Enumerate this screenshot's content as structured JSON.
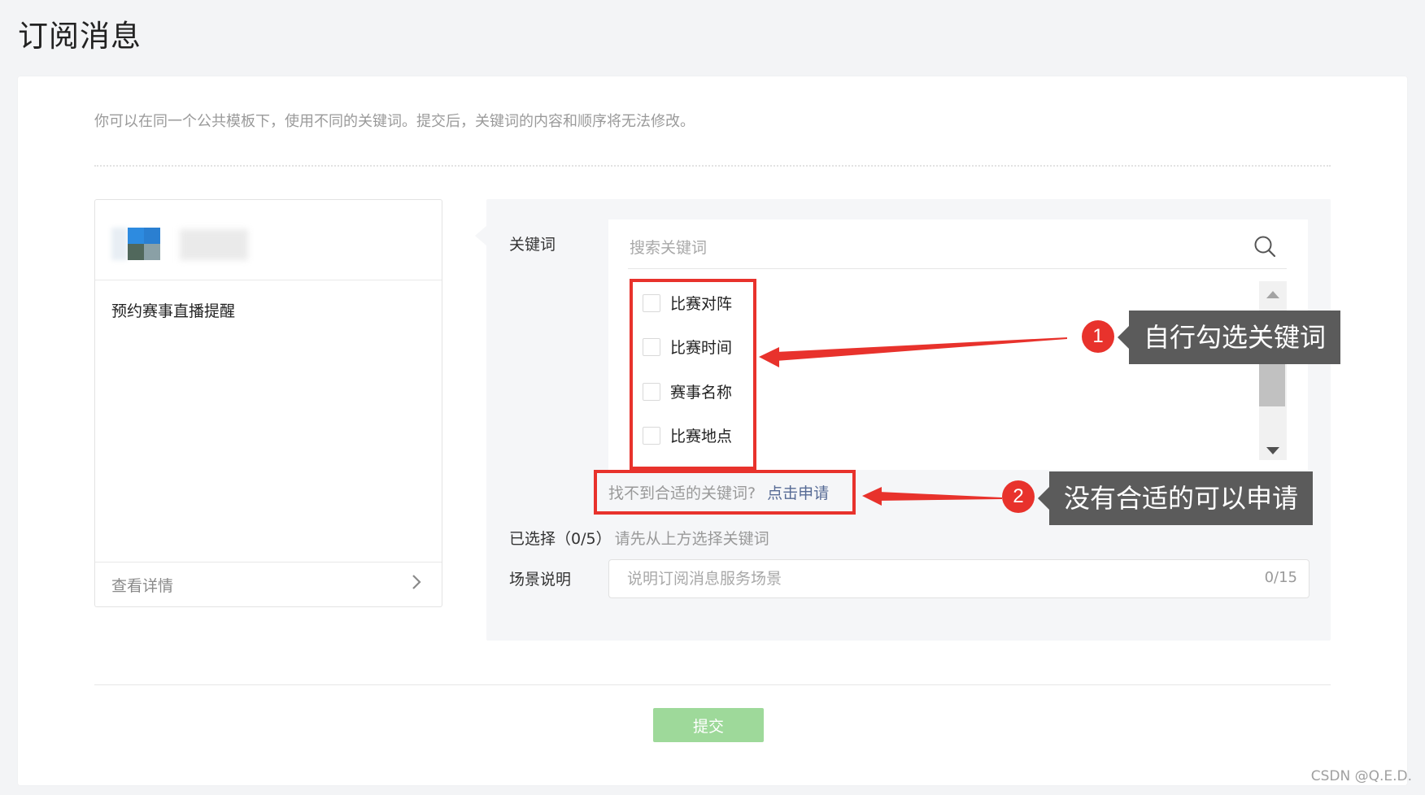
{
  "page": {
    "title": "订阅消息"
  },
  "intro_text": "你可以在同一个公共模板下，使用不同的关键词。提交后，关键词的内容和顺序将无法修改。",
  "template_card": {
    "name": "预约赛事直播提醒",
    "details_label": "查看详情"
  },
  "form": {
    "keyword_label": "关键词",
    "search_placeholder": "搜索关键词",
    "keywords": [
      {
        "label": "比赛对阵",
        "checked": false
      },
      {
        "label": "比赛时间",
        "checked": false
      },
      {
        "label": "赛事名称",
        "checked": false
      },
      {
        "label": "比赛地点",
        "checked": false
      }
    ],
    "not_found_text": "找不到合适的关键词?",
    "apply_link": "点击申请",
    "selected_label": "已选择（0/5）",
    "selected_hint": "请先从上方选择关键词",
    "scene_label": "场景说明",
    "scene_placeholder": "说明订阅消息服务场景",
    "scene_count": "0/15",
    "submit_label": "提交"
  },
  "annotations": [
    {
      "number": "1",
      "text": "自行勾选关键词"
    },
    {
      "number": "2",
      "text": "没有合适的可以申请"
    }
  ],
  "watermark": "CSDN @Q.E.D.",
  "colors": {
    "submit_button": "#9ed99a",
    "link": "#576b95",
    "annotation_red": "#e8322c",
    "callout_bg": "#5b5b5b"
  }
}
